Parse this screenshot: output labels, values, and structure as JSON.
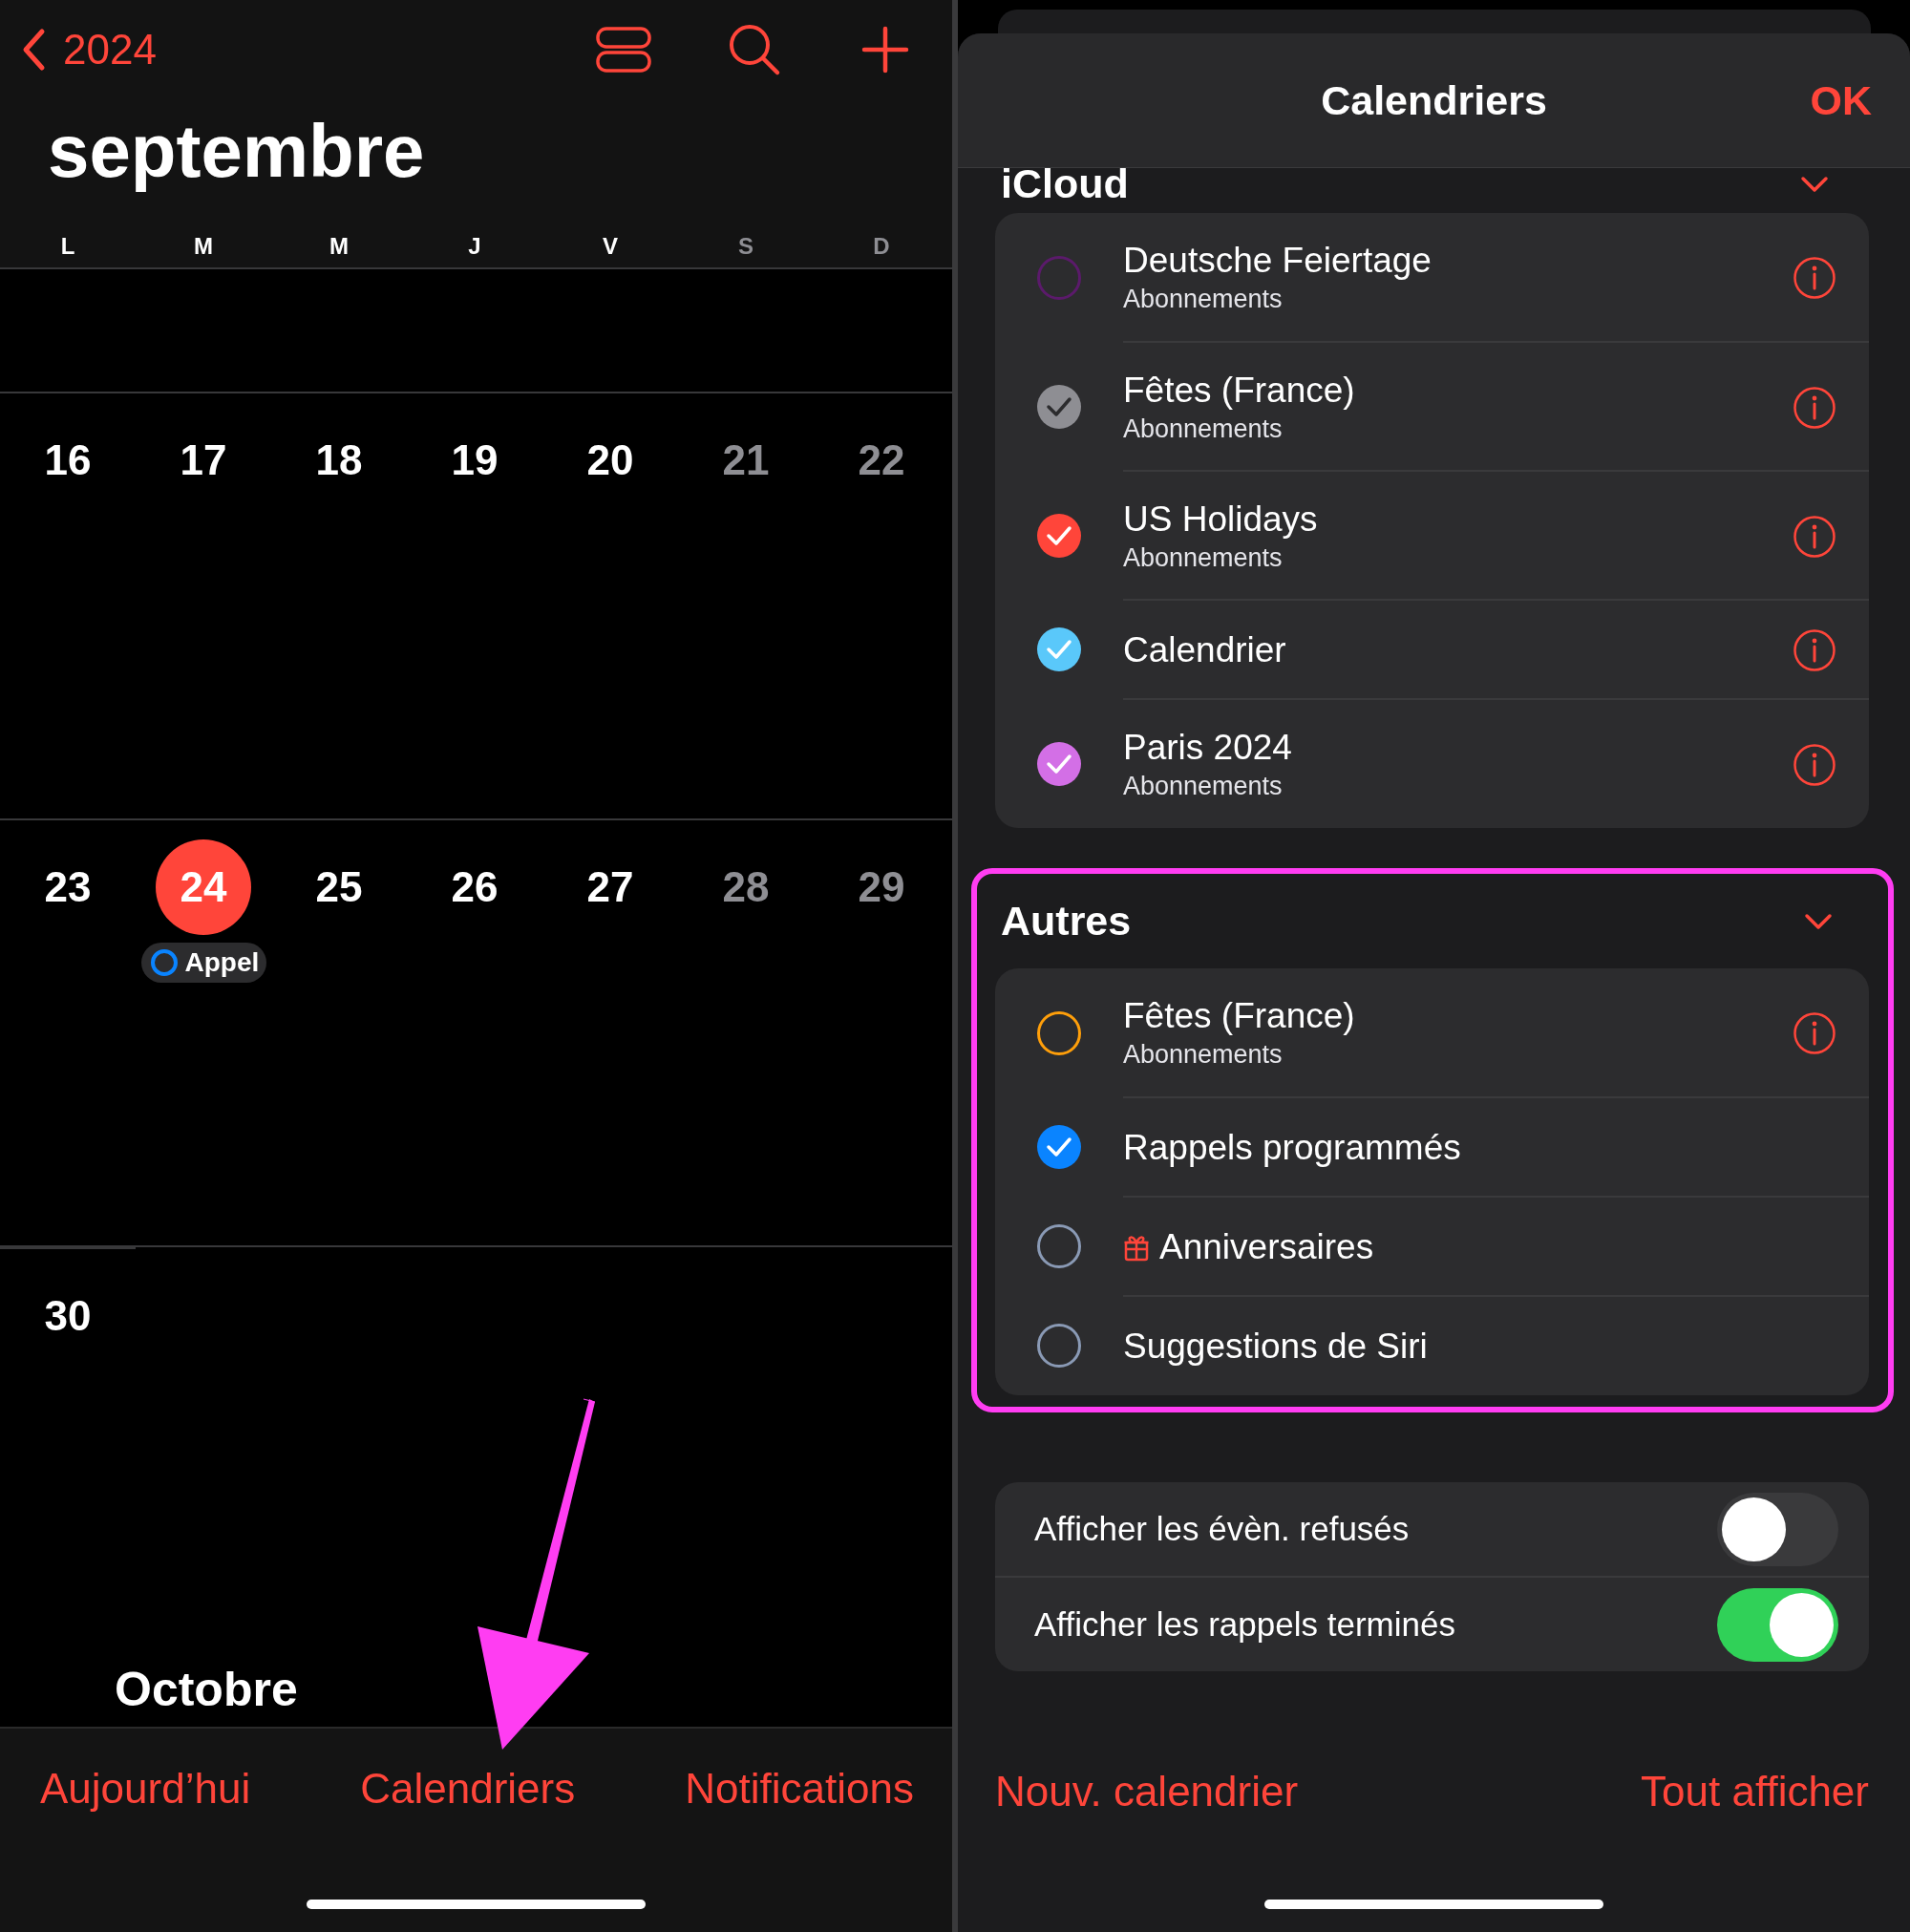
{
  "calendar_view": {
    "back_label": "2024",
    "month": "septembre",
    "weekdays": [
      {
        "label": "L",
        "dimmed": false
      },
      {
        "label": "M",
        "dimmed": false
      },
      {
        "label": "M",
        "dimmed": false
      },
      {
        "label": "J",
        "dimmed": false
      },
      {
        "label": "V",
        "dimmed": false
      },
      {
        "label": "S",
        "dimmed": true
      },
      {
        "label": "D",
        "dimmed": true
      }
    ],
    "weeks": [
      {
        "days": [
          {
            "day": "16",
            "dimmed": false,
            "today": false
          },
          {
            "day": "17",
            "dimmed": false,
            "today": false
          },
          {
            "day": "18",
            "dimmed": false,
            "today": false
          },
          {
            "day": "19",
            "dimmed": false,
            "today": false
          },
          {
            "day": "20",
            "dimmed": false,
            "today": false
          },
          {
            "day": "21",
            "dimmed": true,
            "today": false
          },
          {
            "day": "22",
            "dimmed": true,
            "today": false
          }
        ]
      },
      {
        "days": [
          {
            "day": "23",
            "dimmed": false,
            "today": false
          },
          {
            "day": "24",
            "dimmed": false,
            "today": true,
            "events": [
              {
                "title": "Appel",
                "color": "#0a84ff"
              }
            ]
          },
          {
            "day": "25",
            "dimmed": false,
            "today": false
          },
          {
            "day": "26",
            "dimmed": false,
            "today": false
          },
          {
            "day": "27",
            "dimmed": false,
            "today": false
          },
          {
            "day": "28",
            "dimmed": true,
            "today": false
          },
          {
            "day": "29",
            "dimmed": true,
            "today": false
          }
        ]
      },
      {
        "days": [
          {
            "day": "30",
            "dimmed": false,
            "today": false
          }
        ]
      }
    ],
    "next_month": "Octobre",
    "tab_bar": [
      {
        "label": "Aujourd’hui"
      },
      {
        "label": "Calendriers"
      },
      {
        "label": "Notifications"
      }
    ]
  },
  "calendars_sheet": {
    "title": "Calendriers",
    "done": "OK",
    "sections": [
      {
        "title": "iCloud",
        "highlighted": false,
        "items": [
          {
            "name": "Deutsche Feiertage",
            "subtitle": "Abonnements",
            "checked": false,
            "color": "#5b1a6b",
            "kind": "calendar"
          },
          {
            "name": "Fêtes (France)",
            "subtitle": "Abonnements",
            "checked": true,
            "color": "#8e8e93",
            "kind": "calendar"
          },
          {
            "name": "US Holidays",
            "subtitle": "Abonnements",
            "checked": true,
            "color": "#ff453a",
            "kind": "calendar"
          },
          {
            "name": "Calendrier",
            "checked": true,
            "color": "#5ac8fa",
            "kind": "calendar"
          },
          {
            "name": "Paris 2024",
            "subtitle": "Abonnements",
            "checked": true,
            "color": "#d36fe6",
            "kind": "calendar"
          }
        ]
      },
      {
        "title": "Autres",
        "highlighted": true,
        "items": [
          {
            "name": "Fêtes (France)",
            "subtitle": "Abonnements",
            "checked": false,
            "color": "#ff9f0a",
            "kind": "calendar"
          },
          {
            "name": "Rappels programmés",
            "checked": true,
            "color": "#0a84ff",
            "kind": "reminders"
          },
          {
            "name": "Anniversaires",
            "checked": false,
            "color": "#8a9ab5",
            "kind": "birthdays"
          },
          {
            "name": "Suggestions de Siri",
            "checked": false,
            "color": "#8a9ab5",
            "kind": "reminders"
          }
        ]
      }
    ],
    "toggles": [
      {
        "label": "Afficher les évèn. refusés",
        "on": false
      },
      {
        "label": "Afficher les rappels terminés",
        "on": true
      }
    ],
    "footer": {
      "left": "Nouv. calendrier",
      "right": "Tout afficher"
    }
  },
  "annotation": {
    "kind": "arrow"
  }
}
